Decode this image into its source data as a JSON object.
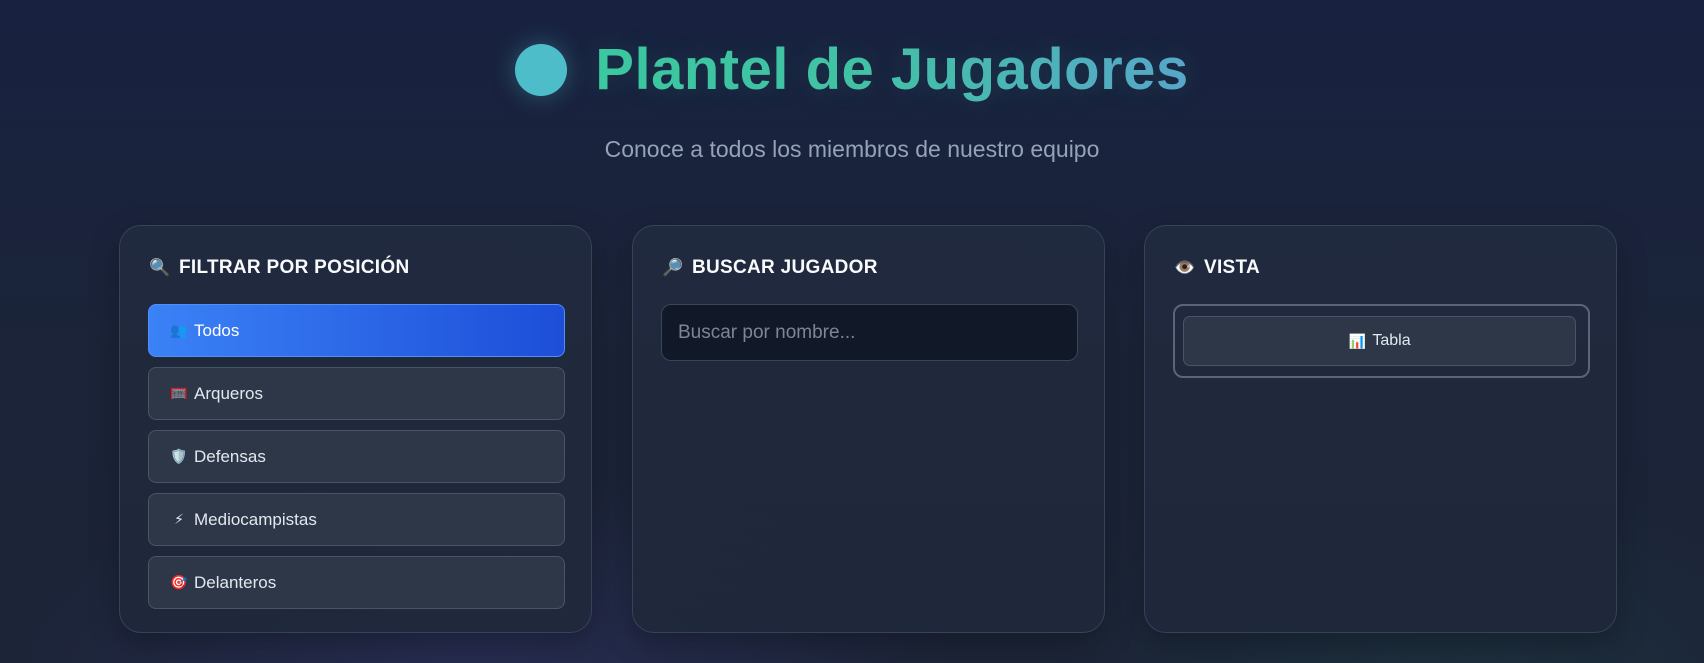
{
  "header": {
    "title": "Plantel de Jugadores",
    "subtitle": "Conoce a todos los miembros de nuestro equipo",
    "accent_gradient": [
      "#3cc9a0",
      "#5aa6cc"
    ]
  },
  "filter": {
    "title": "FILTRAR POR POSICIÓN",
    "icon": "🔍",
    "options": [
      {
        "label": "Todos",
        "icon": "👥",
        "active": true
      },
      {
        "label": "Arqueros",
        "icon": "🥅",
        "active": false
      },
      {
        "label": "Defensas",
        "icon": "🛡️",
        "active": false
      },
      {
        "label": "Mediocampistas",
        "icon": "⚡",
        "active": false
      },
      {
        "label": "Delanteros",
        "icon": "🎯",
        "active": false
      }
    ]
  },
  "search": {
    "title": "BUSCAR JUGADOR",
    "icon": "🔎",
    "placeholder": "Buscar por nombre...",
    "value": ""
  },
  "view": {
    "title": "VISTA",
    "icon": "👁️",
    "button_label": "Tabla",
    "button_icon": "📊"
  },
  "colors": {
    "active_button": "#3b82f6",
    "panel_border": "#36415a",
    "background": "#1b2438"
  }
}
